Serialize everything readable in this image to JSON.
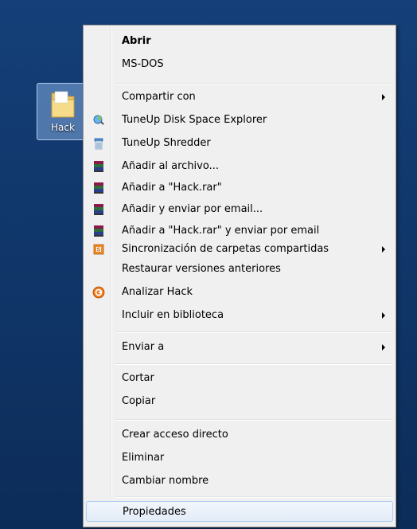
{
  "desktop": {
    "folder_label": "Hack"
  },
  "context_menu": {
    "items": [
      {
        "label": "Abrir",
        "bold": true,
        "icon": null,
        "submenu": false
      },
      {
        "label": "MS-DOS",
        "icon": null,
        "submenu": false
      },
      {
        "label": "Compartir con",
        "icon": null,
        "submenu": true
      },
      {
        "label": "TuneUp Disk Space Explorer",
        "icon": "tuneup-disk-space-explorer-icon",
        "submenu": false
      },
      {
        "label": "TuneUp Shredder",
        "icon": "tuneup-shredder-icon",
        "submenu": false
      },
      {
        "label": "Añadir al archivo...",
        "icon": "winrar-icon",
        "submenu": false
      },
      {
        "label": "Añadir a \"Hack.rar\"",
        "icon": "winrar-icon",
        "submenu": false
      },
      {
        "label": "Añadir y enviar por email...",
        "icon": "winrar-icon",
        "submenu": false
      },
      {
        "label": "Añadir a \"Hack.rar\" y enviar por email",
        "icon": "winrar-icon",
        "submenu": false
      },
      {
        "label": "Sincronización de carpetas compartidas",
        "icon": "sync-shared-folders-icon",
        "submenu": true
      },
      {
        "label": "Restaurar versiones anteriores",
        "icon": null,
        "submenu": false
      },
      {
        "label": "Analizar Hack",
        "icon": "antivirus-scan-icon",
        "submenu": false
      },
      {
        "label": "Incluir en biblioteca",
        "icon": null,
        "submenu": true
      },
      {
        "label": "Enviar a",
        "icon": null,
        "submenu": true
      },
      {
        "label": "Cortar",
        "icon": null,
        "submenu": false
      },
      {
        "label": "Copiar",
        "icon": null,
        "submenu": false
      },
      {
        "label": "Crear acceso directo",
        "icon": null,
        "submenu": false
      },
      {
        "label": "Eliminar",
        "icon": null,
        "submenu": false
      },
      {
        "label": "Cambiar nombre",
        "icon": null,
        "submenu": false
      },
      {
        "label": "Propiedades",
        "icon": null,
        "submenu": false,
        "highlighted": true
      }
    ]
  },
  "colors": {
    "desktop_background": "#123a6e",
    "menu_background": "#f0f0f0",
    "highlight_border": "#aecdf3"
  }
}
